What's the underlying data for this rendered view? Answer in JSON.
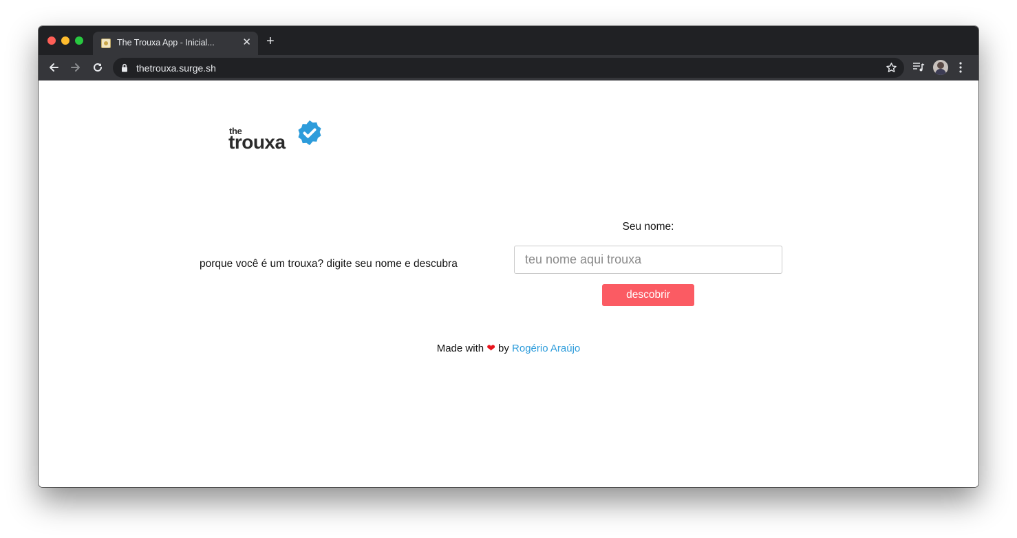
{
  "browser": {
    "tab_title": "The Trouxa App - Inicial...",
    "tab_close": "✕",
    "new_tab": "+",
    "url": "thetrouxa.surge.sh"
  },
  "logo": {
    "the": "the",
    "word": "trouxa",
    "badge_color": "#2d9cdb"
  },
  "main": {
    "prompt": "porque você é um trouxa? digite seu nome e descubra",
    "name_label": "Seu nome:",
    "name_placeholder": "teu nome aqui trouxa",
    "name_value": "",
    "button_label": "descobrir",
    "button_color": "#fb5b63"
  },
  "footer": {
    "made_with": "Made with",
    "heart": "❤",
    "by": "by",
    "author": "Rogério Araújo",
    "link_color": "#2d9cdb"
  }
}
